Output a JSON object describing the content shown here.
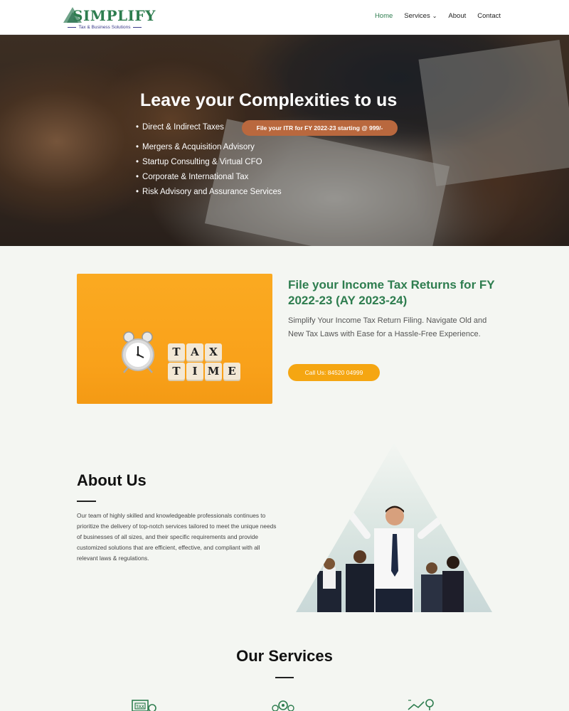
{
  "header": {
    "logo_text": "SIMPLIFY",
    "logo_tagline": "Tax & Business Solutions",
    "nav": [
      {
        "label": "Home",
        "active": true
      },
      {
        "label": "Services",
        "has_dropdown": true
      },
      {
        "label": "About"
      },
      {
        "label": "Contact"
      }
    ]
  },
  "hero": {
    "title": "Leave your Complexities to us",
    "items": [
      "Direct & Indirect Taxes",
      "Mergers & Acquisition Advisory",
      "Startup Consulting & Virtual CFO",
      "Corporate & International Tax",
      "Risk Advisory and Assurance Services"
    ],
    "promo": "File your ITR for FY 2022-23 starting @ 999/-"
  },
  "itr": {
    "image_blocks_row1": [
      "T",
      "A",
      "X"
    ],
    "image_blocks_row2": [
      "T",
      "I",
      "M",
      "E"
    ],
    "title": "File your Income Tax Returns for FY 2022-23 (AY 2023-24)",
    "description": "Simplify Your  Income Tax Return  Filing. Navigate Old  and  New Tax Laws with Ease for a Hassle-Free Experience.",
    "button": "Call Us: 84520 04999"
  },
  "about": {
    "title": "About Us",
    "text": "Our team of highly skilled and knowledgeable professionals continues to prioritize the delivery of top-notch services tailored to meet the unique needs of businesses of all sizes, and their specific requirements and provide customized solutions that are efficient, effective, and compliant with all relevant laws & regulations."
  },
  "services": {
    "title": "Our Services",
    "icons": [
      "tax-document-icon",
      "gears-icon",
      "growth-idea-icon"
    ]
  },
  "colors": {
    "brand_green": "#2e7d4f",
    "accent_orange": "#f5a612",
    "promo_brown": "#b9683e",
    "page_bg": "#f4f6f2"
  }
}
